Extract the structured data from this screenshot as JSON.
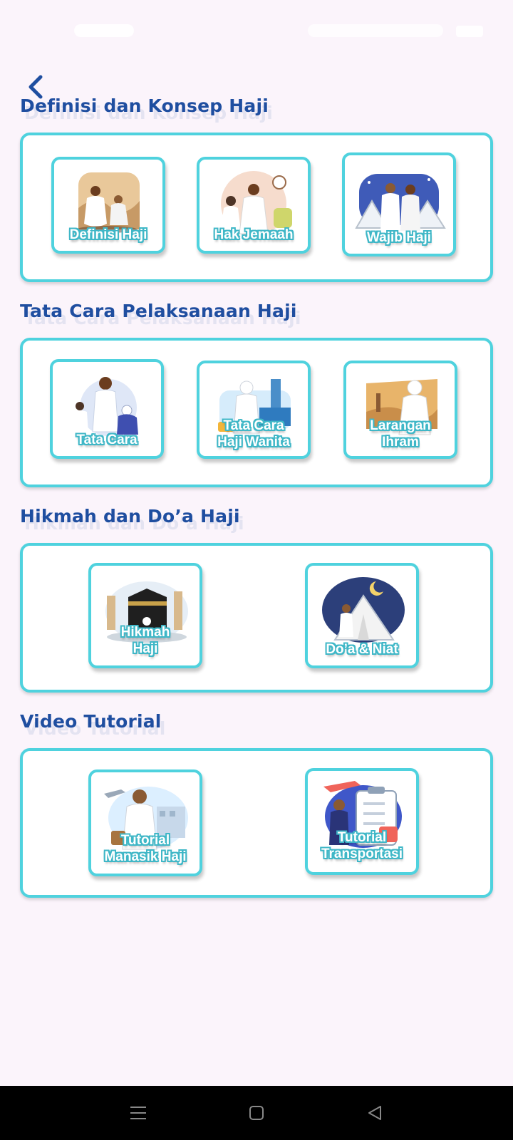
{
  "sections": [
    {
      "title": "Definisi dan Konsep Haji",
      "items": [
        {
          "label": "Definisi Haji",
          "icon": "pilgrims-in-desert-icon"
        },
        {
          "label": "Hak Jemaah",
          "icon": "pilgrim-couple-icon"
        },
        {
          "label": "Wajib  Haji",
          "icon": "pilgrims-tents-icon"
        }
      ]
    },
    {
      "title": "Tata Cara Pelaksanaan Haji",
      "items": [
        {
          "label": "Tata Cara",
          "icon": "praying-family-icon"
        },
        {
          "label": "Tata Cara Haji Wanita",
          "label_lines": [
            "Tata Cara",
            "Haji Wanita"
          ],
          "icon": "woman-pilgrim-airport-icon"
        },
        {
          "label": "Larangan Ihram",
          "label_lines": [
            "Larangan",
            "Ihram"
          ],
          "icon": "woman-praying-icon"
        }
      ]
    },
    {
      "title": "Hikmah dan Do’a Haji",
      "items": [
        {
          "label": "Hikmah Haji",
          "label_lines": [
            "Hikmah",
            "Haji"
          ],
          "icon": "kaaba-icon"
        },
        {
          "label": "Do’a & Niat",
          "icon": "tent-night-icon"
        }
      ]
    },
    {
      "title": "Video Tutorial",
      "items": [
        {
          "label": "Tutorial Manasik Haji",
          "label_lines": [
            "Tutorial",
            "Manasik Haji"
          ],
          "icon": "pilgrim-waving-icon"
        },
        {
          "label": "Tutorial Transportasi",
          "label_lines": [
            "Tutorial",
            "Transportasi"
          ],
          "icon": "clipboard-plane-icon"
        }
      ]
    }
  ],
  "colors": {
    "accent": "#4fd2de",
    "title": "#1f4ea0",
    "background": "#fbf4fb"
  },
  "nav": {
    "back_icon": "chevron-left-icon",
    "system_nav": [
      "menu-icon",
      "home-icon",
      "back-triangle-icon"
    ]
  }
}
